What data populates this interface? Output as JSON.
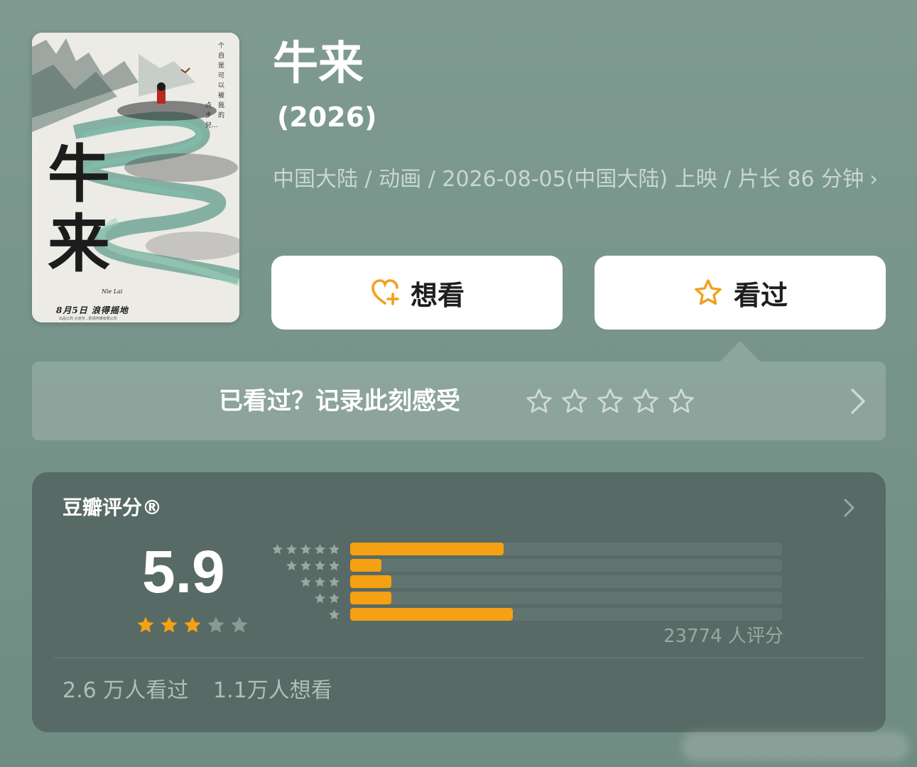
{
  "movie": {
    "title": "牛来",
    "year": "(2026)",
    "meta": "中国大陆 / 动画 / 2026-08-05(中国大陆) 上映 / 片长 86 分钟",
    "chevron": "›"
  },
  "poster": {
    "title_chars": "牛来",
    "vertical_text_1": "个自是可以被我的",
    "vertical_text_2": "点步兒…",
    "subtitle": "Nie Lai",
    "date_line": "8月5日  浪得摇地",
    "credit_line": "出品公司 大连市…影视传媒有限公司"
  },
  "actions": {
    "want_label": "想看",
    "want_icon": "heart-plus-icon",
    "seen_label": "看过",
    "seen_icon": "star-outline-icon"
  },
  "rate_prompt": {
    "label": "已看过？记录此刻感受",
    "star_count": 5
  },
  "rating": {
    "title": "豆瓣评分®",
    "score": "5.9",
    "stars_filled": 3,
    "stars_total": 5,
    "distribution": [
      {
        "stars": 5,
        "fraction": 0.356
      },
      {
        "stars": 4,
        "fraction": 0.072
      },
      {
        "stars": 3,
        "fraction": 0.096
      },
      {
        "stars": 2,
        "fraction": 0.096
      },
      {
        "stars": 1,
        "fraction": 0.377
      }
    ],
    "count_text": "23774 人评分",
    "watched_text": "2.6 万人看过",
    "wish_text": "1.1万人想看"
  },
  "colors": {
    "accent_orange": "#f6a014",
    "background": "#7e9a91",
    "card": "#586a65"
  }
}
